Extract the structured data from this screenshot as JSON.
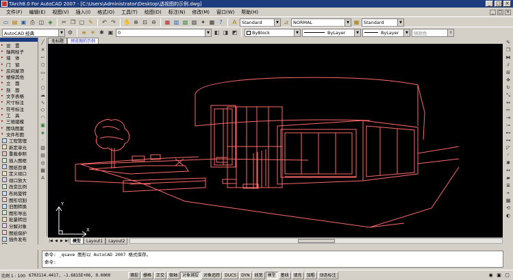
{
  "window": {
    "title": "TArch8.0 For AutoCAD 2007 - [C:\\Users\\Administrator\\Desktop\\透视图的示例.dwg]"
  },
  "menu": [
    "文件(F)",
    "编辑(E)",
    "视图(V)",
    "插入(I)",
    "格式(O)",
    "工具(T)",
    "绘图(D)",
    "标注(N)",
    "修改(M)",
    "窗口(W)",
    "帮助(H)"
  ],
  "toolbar1": {
    "textstyle": "Standard",
    "dimstyle": "NORMAL",
    "tablestyle": "Standard"
  },
  "toolbar2": {
    "workspace": "AutoCAD 经典",
    "layer": "0",
    "color": "ByBlock",
    "linetype": "ByLayer",
    "lineweight": "ByLayer",
    "plotstyle": "随颜色"
  },
  "sidepanel": {
    "top": [
      "设　置",
      "轴网柱子",
      "墙　体",
      "门　窗",
      "房间屋顶",
      "楼梯其他",
      "立　面",
      "剖　面",
      "文字表格",
      "尺寸标注",
      "符号标注",
      "工　具",
      "三维建模",
      "图块图案",
      "文件布图"
    ],
    "bottom": [
      "工程管理",
      "新定单元",
      "重载参照",
      "插入图框",
      "图纸目录",
      "定义视口",
      "视口放大",
      "改变比例",
      "布局旋转",
      "图形切割",
      "旧图转换",
      "图形导出",
      "批量转旧",
      "分解对象",
      "图纸保护",
      "插件发布",
      "图层转换"
    ]
  },
  "doctabs": [
    "无标题",
    "预览图的示例"
  ],
  "layouttabs": [
    "模型",
    "Layout1",
    "Layout2"
  ],
  "command": {
    "line1": "命令: _qsave 图形以 AutoCAD 2007 格式保存。",
    "line2": "命令:"
  },
  "status": {
    "scale": "比例 1 : 100",
    "coords": "6703114.4417, -1.6815E+06, 0.0000",
    "buttons": [
      "捕捉",
      "栅格",
      "正交",
      "极轴",
      "对象捕捉",
      "对象追踪",
      "DUCS",
      "DYN",
      "线宽",
      "模型",
      "基线",
      "填充",
      "加粗",
      "动态标注"
    ],
    "active": [
      4,
      9
    ]
  },
  "ucs": {
    "x_label": "X",
    "y_label": "Y"
  }
}
